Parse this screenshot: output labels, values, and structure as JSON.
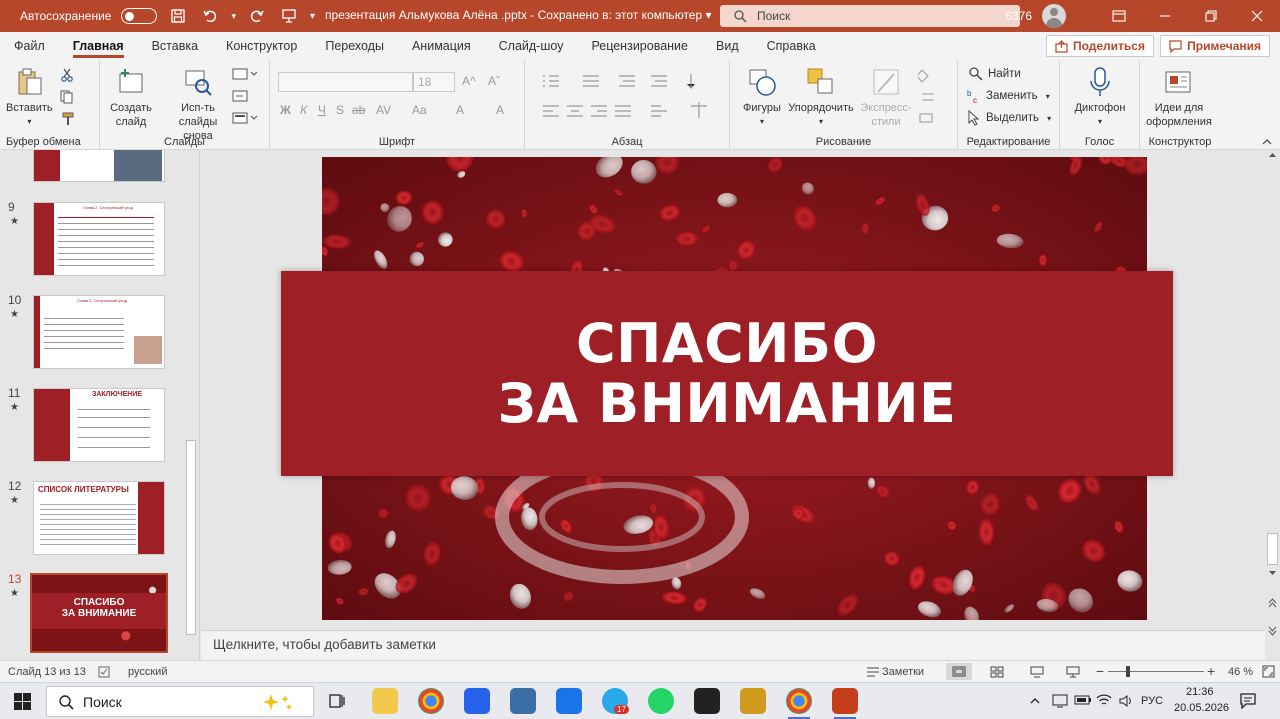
{
  "titlebar": {
    "autosave_label": "Автосохранение",
    "doc_title": "презентация Альмукова Алёна .pptx  -  Сохранено в: этот компьютер  ▾",
    "search_placeholder": "Поиск",
    "user_number": "6376"
  },
  "menu": {
    "tabs": [
      "Файл",
      "Главная",
      "Вставка",
      "Конструктор",
      "Переходы",
      "Анимация",
      "Слайд-шоу",
      "Рецензирование",
      "Вид",
      "Справка"
    ],
    "share_label": "Поделиться",
    "comments_label": "Примечания"
  },
  "ribbon": {
    "clipboard": {
      "paste": "Вставить",
      "group": "Буфер обмена"
    },
    "slides": {
      "new_slide": "Создать слайд",
      "reuse": "Исп-ть слайды снова",
      "group": "Слайды"
    },
    "font": {
      "size": "18",
      "group": "Шрифт",
      "format_glyphs": [
        "Ж",
        "К",
        "Ч",
        "S",
        "ab",
        "AV",
        "Aa",
        "A",
        "A"
      ]
    },
    "paragraph": {
      "group": "Абзац"
    },
    "drawing": {
      "shapes": "Фигуры",
      "arrange": "Упорядочить",
      "styles": "Экспресс-стили",
      "group": "Рисование"
    },
    "editing": {
      "find": "Найти",
      "replace": "Заменить",
      "select": "Выделить",
      "group": "Редактирование"
    },
    "voice": {
      "dictate": "Диктофон",
      "group": "Голос"
    },
    "designer": {
      "ideas": "Идеи для оформления",
      "group": "Конструктор"
    }
  },
  "thumbnails": [
    {
      "num": "9",
      "title": "Глава 2. Сестринский уход"
    },
    {
      "num": "10",
      "title": "Глава 2. Сестринский уход"
    },
    {
      "num": "11",
      "title": "ЗАКЛЮЧЕНИЕ"
    },
    {
      "num": "12",
      "title": "СПИСОК ЛИТЕРАТУРЫ"
    },
    {
      "num": "13",
      "title": "СПАСИБО ЗА ВНИМАНИЕ"
    }
  ],
  "slide": {
    "line1": "СПАСИБО",
    "line2": "ЗА ВНИМАНИЕ"
  },
  "notes_placeholder": "Щелкните, чтобы добавить заметки",
  "status": {
    "slide_counter": "Слайд 13 из 13",
    "language": "русский",
    "notes_btn": "Заметки",
    "zoom": "46 %"
  },
  "taskbar": {
    "search": "Поиск",
    "lang": "РУС",
    "time": "21:36",
    "date": "20.05.2026",
    "telegram_badge": "17"
  },
  "colors": {
    "accent": "#b7472a",
    "slide_red": "#9e1f25"
  }
}
